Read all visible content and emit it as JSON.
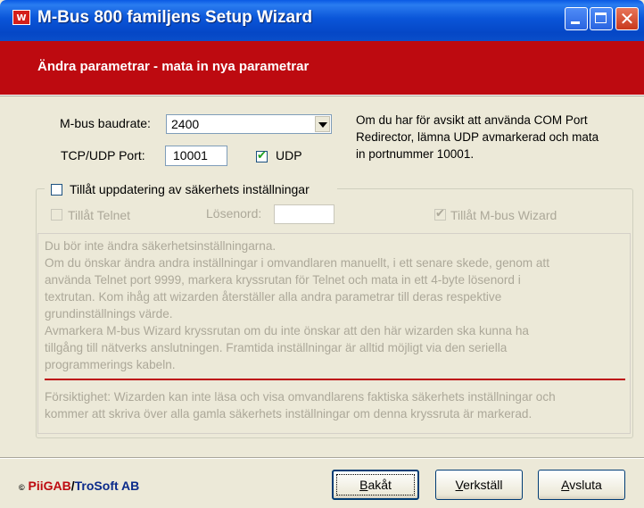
{
  "window": {
    "title": "M-Bus 800 familjens Setup Wizard",
    "icon_text": "W"
  },
  "header": {
    "title": "Ändra parametrar - mata in nya parametrar"
  },
  "settings": {
    "baudrate_label": "M-bus baudrate:",
    "baudrate_value": "2400",
    "port_label": "TCP/UDP Port:",
    "port_value": "10001",
    "udp_label": "UDP",
    "udp_checked": true,
    "info_lines": [
      "Om du har för avsikt att använda COM Port",
      "Redirector, lämna UDP avmarkerad och mata",
      "in portnummer 10001."
    ]
  },
  "security": {
    "group_label": "Tillåt uppdatering av säkerhets inställningar",
    "telnet_label": "Tillåt Telnet",
    "password_label": "Lösenord:",
    "password_value": "",
    "wizard_label": "Tillåt M-bus Wizard",
    "wizard_checked": true
  },
  "notes": {
    "para1": [
      "Du bör inte ändra säkerhetsinställningarna.",
      "Om du önskar ändra andra inställningar i omvandlaren manuellt, i ett senare skede, genom att",
      "använda  Telnet port 9999, markera kryssrutan för Telnet och mata in ett 4-byte lösenord i",
      "textrutan. Kom ihåg att wizarden återställer alla andra parametrar till deras respektive",
      "grundinställnings värde.",
      "Avmarkera M-bus Wizard kryssrutan om du inte önskar att den här wizarden ska kunna ha",
      "tillgång till nätverks anslutningen. Framtida inställningar är alltid möjligt via den seriella",
      "programmerings kabeln."
    ],
    "para2": [
      "Försiktighet: Wizarden kan inte läsa och visa omvandlarens faktiska säkerhets inställningar och",
      "kommer att skriva över alla gamla säkerhets inställningar om denna kryssruta är markerad."
    ]
  },
  "footer": {
    "copyright_symbol": "©",
    "company_a": "PiiGAB",
    "separator": "/",
    "company_b": "TroSoft AB",
    "buttons": {
      "back": {
        "underline": "B",
        "rest": "akåt"
      },
      "apply": {
        "underline": "V",
        "rest": "erkställ"
      },
      "exit": {
        "underline": "A",
        "rest": "vsluta"
      }
    }
  },
  "colors": {
    "title_bar": "#0a55d8",
    "header_red": "#bd0a10",
    "dialog_bg": "#ece9d8",
    "disabled_text": "#aca899"
  }
}
